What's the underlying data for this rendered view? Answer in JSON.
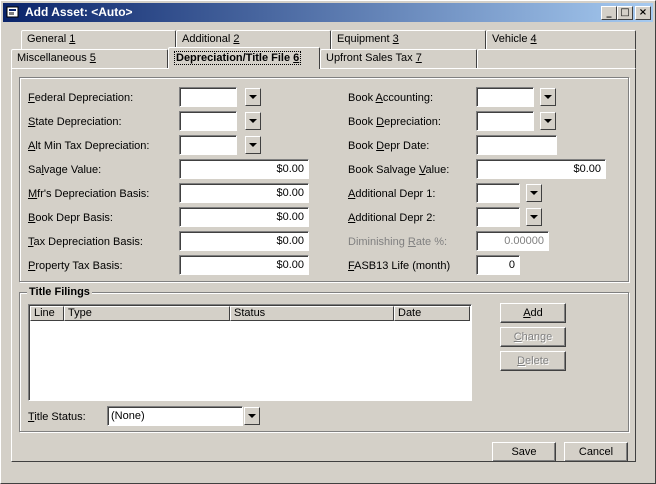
{
  "window": {
    "title": "Add Asset: <Auto>",
    "minimize_glyph": "_",
    "maximize_glyph": "□",
    "close_glyph": "×"
  },
  "tabs": {
    "row1": [
      {
        "pre": "General ",
        "key": "1",
        "post": ""
      },
      {
        "pre": "Additional ",
        "key": "2",
        "post": ""
      },
      {
        "pre": "Equipment ",
        "key": "3",
        "post": ""
      },
      {
        "pre": "Vehicle ",
        "key": "4",
        "post": ""
      }
    ],
    "row2": [
      {
        "pre": "Miscellaneous ",
        "key": "5",
        "post": ""
      },
      {
        "pre": "Depreciation/Title File ",
        "key": "6",
        "post": ""
      },
      {
        "pre": "Upfront Sales Tax ",
        "key": "7",
        "post": ""
      }
    ],
    "active": "Depreciation/Title File 6"
  },
  "left_fields": [
    {
      "key": "F",
      "rest": "ederal Depreciation:",
      "value": ""
    },
    {
      "key": "S",
      "rest": "tate Depreciation:",
      "value": ""
    },
    {
      "key": "A",
      "rest": "lt Min Tax Depreciation:",
      "value": ""
    },
    {
      "pre": "Sa",
      "key": "l",
      "rest": "vage Value:",
      "value": "$0.00"
    },
    {
      "key": "M",
      "rest": "fr's Depreciation Basis:",
      "value": "$0.00"
    },
    {
      "key": "B",
      "rest": "ook Depr Basis:",
      "value": "$0.00"
    },
    {
      "key": "T",
      "rest": "ax Depreciation Basis:",
      "value": "$0.00"
    },
    {
      "key": "P",
      "rest": "roperty Tax Basis:",
      "value": "$0.00"
    }
  ],
  "right_fields": [
    {
      "pre": "Book ",
      "key": "A",
      "rest": "ccounting:",
      "value": ""
    },
    {
      "pre": "Book ",
      "key": "D",
      "rest": "epreciation:",
      "value": ""
    },
    {
      "pre": "Book ",
      "key": "D",
      "rest": "epr Date:",
      "value": ""
    },
    {
      "pre": "Book Salvage ",
      "key": "V",
      "rest": "alue:",
      "value": "$0.00"
    },
    {
      "key": "A",
      "rest": "dditional Depr 1:",
      "value": ""
    },
    {
      "key": "A",
      "rest": "dditional Depr 2:",
      "value": ""
    },
    {
      "pre": "Diminishing ",
      "key": "R",
      "rest": "ate %:",
      "value": "0.00000"
    },
    {
      "key": "F",
      "rest": "ASB13 Life (month)",
      "value": "0"
    }
  ],
  "title_filings": {
    "group_label": "Title Filings",
    "columns": [
      "Line",
      "Type",
      "Status",
      "Date"
    ],
    "rows": [],
    "buttons": [
      {
        "key": "A",
        "rest": "dd"
      },
      {
        "key": "C",
        "rest": "hange"
      },
      {
        "key": "D",
        "rest": "elete"
      }
    ],
    "status_label_key": "T",
    "status_label_rest": "itle Status:",
    "status_value": "(None)"
  },
  "footer": {
    "save_label": "Save",
    "cancel_label": "Cancel"
  },
  "colors": {
    "face": "#d4d0c8",
    "title_start": "#0a246a",
    "title_end": "#a6caf0",
    "disabled_text": "#808080"
  }
}
